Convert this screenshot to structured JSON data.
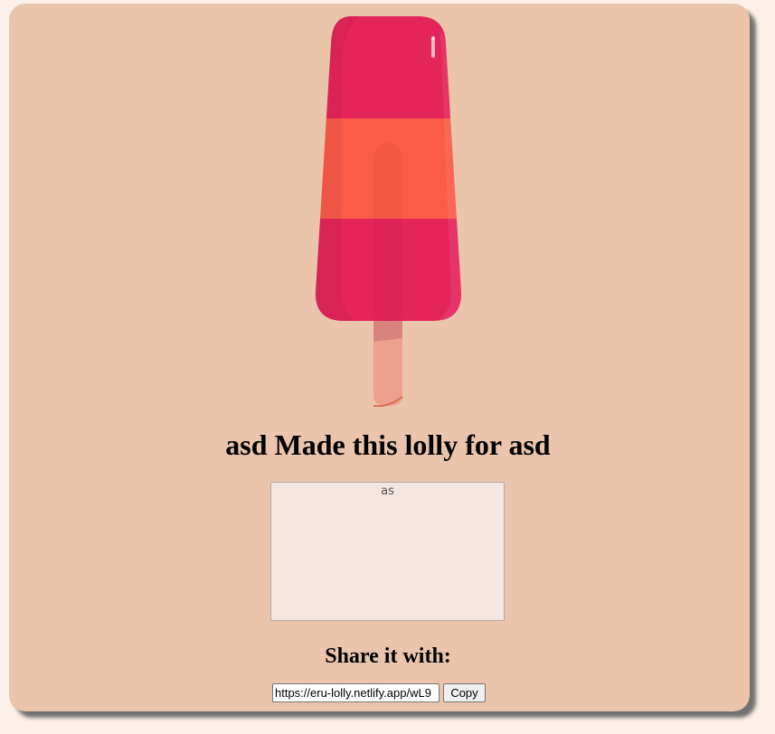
{
  "lolly": {
    "colors": {
      "top": "#e3255a",
      "middle": "#fa5c48",
      "bottom": "#e3255a",
      "stick": "#eda08e"
    }
  },
  "message": {
    "title": "asd Made this lolly for asd",
    "body": "as"
  },
  "share": {
    "heading": "Share it with:",
    "link_value": "https://eru-lolly.netlify.app/wL9",
    "copy_label": "Copy"
  }
}
